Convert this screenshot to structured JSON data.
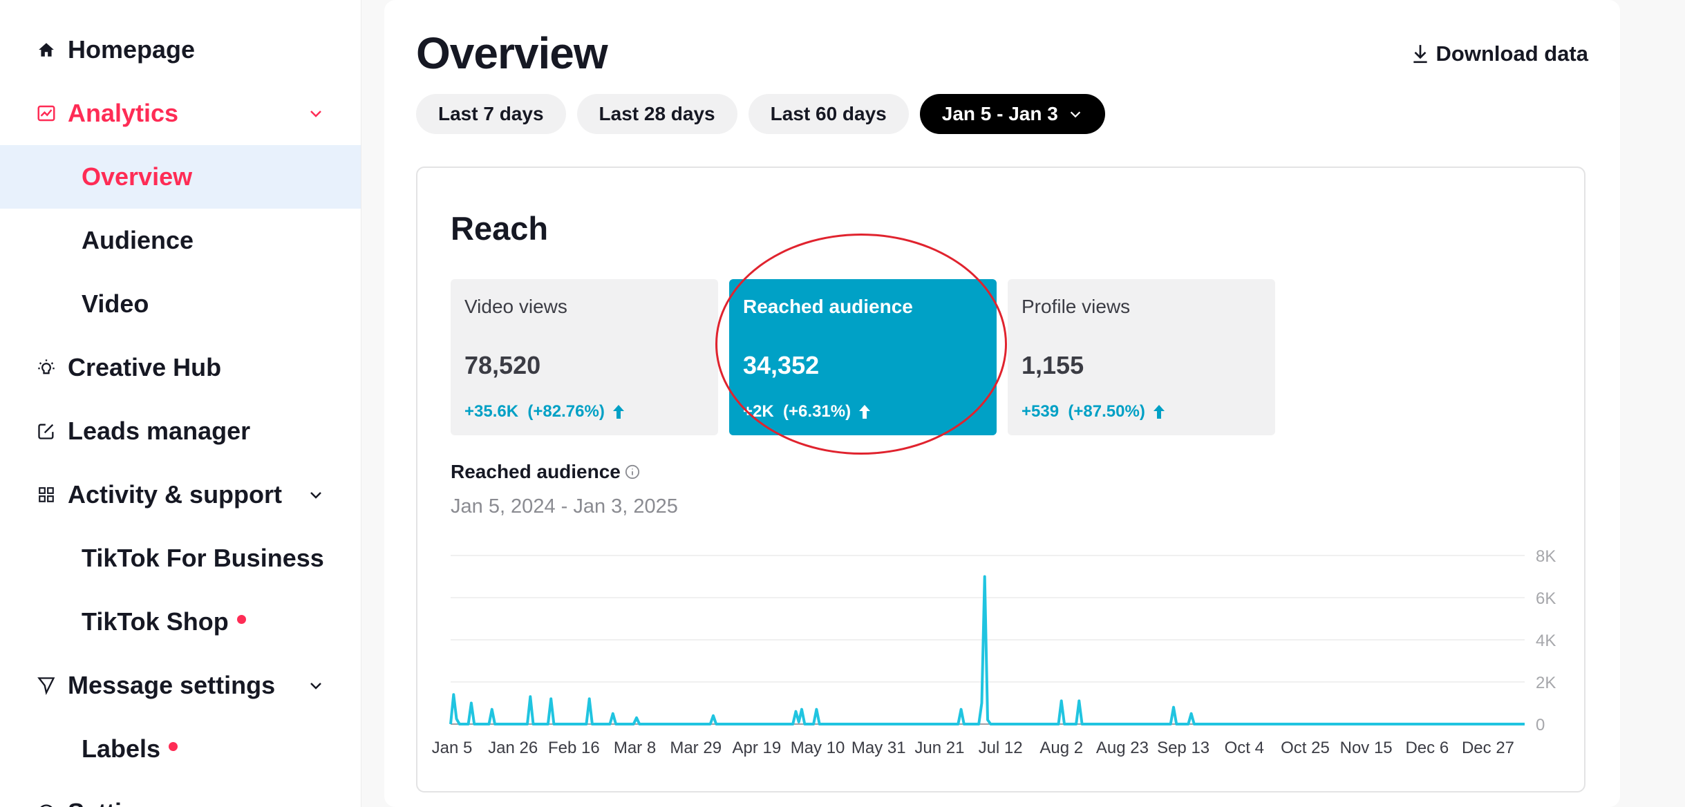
{
  "sidebar": {
    "items": [
      {
        "label": "Homepage"
      },
      {
        "label": "Analytics"
      },
      {
        "label": "Overview"
      },
      {
        "label": "Audience"
      },
      {
        "label": "Video"
      },
      {
        "label": "Creative Hub"
      },
      {
        "label": "Leads manager"
      },
      {
        "label": "Activity & support"
      },
      {
        "label": "TikTok For Business"
      },
      {
        "label": "TikTok Shop"
      },
      {
        "label": "Message settings"
      },
      {
        "label": "Labels"
      },
      {
        "label": "Settings"
      }
    ]
  },
  "header": {
    "title": "Overview",
    "download_label": "Download data"
  },
  "filters": {
    "items": [
      "Last 7 days",
      "Last 28 days",
      "Last 60 days"
    ],
    "selected": "Jan 5 - Jan 3"
  },
  "reach": {
    "title": "Reach",
    "metrics": [
      {
        "label": "Video views",
        "value": "78,520",
        "change": "+35.6K",
        "pct": "(+82.76%)"
      },
      {
        "label": "Reached audience",
        "value": "34,352",
        "change": "+2K",
        "pct": "(+6.31%)"
      },
      {
        "label": "Profile views",
        "value": "1,155",
        "change": "+539",
        "pct": "(+87.50%)"
      }
    ]
  },
  "colors": {
    "accent": "#fe2c55",
    "teal": "#00a1c6",
    "line": "#20c4e0",
    "annotation": "#e0232e"
  },
  "chart_data": {
    "type": "line",
    "title": "Reached audience",
    "subtitle": "Jan 5, 2024 - Jan 3, 2025",
    "x_ticks": [
      "Jan 5",
      "Jan 26",
      "Feb 16",
      "Mar 8",
      "Mar 29",
      "Apr 19",
      "May 10",
      "May 31",
      "Jun 21",
      "Jul 12",
      "Aug 2",
      "Aug 23",
      "Sep 13",
      "Oct 4",
      "Oct 25",
      "Nov 15",
      "Dec 6",
      "Dec 27"
    ],
    "y_ticks": [
      "8K",
      "6K",
      "4K",
      "2K",
      "0"
    ],
    "ylim": [
      0,
      8000
    ],
    "grid": true,
    "series": [
      {
        "values": [
          [
            "2024-01-05",
            0
          ],
          [
            "2024-01-06",
            1400
          ],
          [
            "2024-01-07",
            250
          ],
          [
            "2024-01-08",
            0
          ],
          [
            "2024-01-11",
            0
          ],
          [
            "2024-01-12",
            1000
          ],
          [
            "2024-01-13",
            0
          ],
          [
            "2024-01-18",
            0
          ],
          [
            "2024-01-19",
            700
          ],
          [
            "2024-01-20",
            0
          ],
          [
            "2024-01-31",
            0
          ],
          [
            "2024-02-01",
            1300
          ],
          [
            "2024-02-02",
            0
          ],
          [
            "2024-02-07",
            0
          ],
          [
            "2024-02-08",
            1200
          ],
          [
            "2024-02-09",
            0
          ],
          [
            "2024-02-20",
            0
          ],
          [
            "2024-02-21",
            1200
          ],
          [
            "2024-02-22",
            0
          ],
          [
            "2024-02-28",
            0
          ],
          [
            "2024-02-29",
            500
          ],
          [
            "2024-03-01",
            0
          ],
          [
            "2024-03-07",
            0
          ],
          [
            "2024-03-08",
            300
          ],
          [
            "2024-03-09",
            0
          ],
          [
            "2024-04-02",
            0
          ],
          [
            "2024-04-03",
            400
          ],
          [
            "2024-04-04",
            0
          ],
          [
            "2024-04-30",
            0
          ],
          [
            "2024-05-01",
            600
          ],
          [
            "2024-05-02",
            100
          ],
          [
            "2024-05-03",
            700
          ],
          [
            "2024-05-04",
            0
          ],
          [
            "2024-05-07",
            0
          ],
          [
            "2024-05-08",
            700
          ],
          [
            "2024-05-09",
            0
          ],
          [
            "2024-06-25",
            0
          ],
          [
            "2024-06-26",
            700
          ],
          [
            "2024-06-27",
            0
          ],
          [
            "2024-07-02",
            0
          ],
          [
            "2024-07-03",
            1000
          ],
          [
            "2024-07-04",
            7000
          ],
          [
            "2024-07-05",
            200
          ],
          [
            "2024-07-06",
            0
          ],
          [
            "2024-07-29",
            0
          ],
          [
            "2024-07-30",
            1100
          ],
          [
            "2024-07-31",
            0
          ],
          [
            "2024-08-04",
            0
          ],
          [
            "2024-08-05",
            1100
          ],
          [
            "2024-08-06",
            0
          ],
          [
            "2024-09-05",
            0
          ],
          [
            "2024-09-06",
            800
          ],
          [
            "2024-09-07",
            0
          ],
          [
            "2024-09-11",
            0
          ],
          [
            "2024-09-12",
            500
          ],
          [
            "2024-09-13",
            0
          ],
          [
            "2025-01-03",
            0
          ]
        ]
      }
    ]
  }
}
